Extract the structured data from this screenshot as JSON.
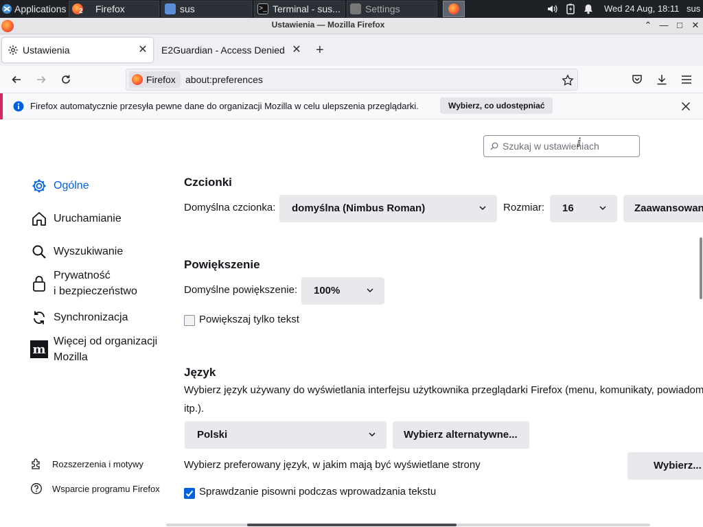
{
  "taskbar": {
    "applications_label": "Applications",
    "windows": [
      {
        "title": "Firefox",
        "icon": "firefox-icon"
      },
      {
        "title": "sus",
        "icon": "home-folder-icon"
      },
      {
        "title": "Terminal - sus...",
        "icon": "terminal-icon"
      },
      {
        "title": "Settings",
        "icon": "settings-icon"
      }
    ],
    "firefox_badge": "2",
    "clock": "Wed 24 Aug, 18:11",
    "user": "sus"
  },
  "window": {
    "title": "Ustawienia — Mozilla Firefox"
  },
  "tabs": [
    {
      "label": "Ustawienia",
      "icon": "gear-icon",
      "selected": true
    },
    {
      "label": "E2Guardian - Access Denied",
      "selected": false
    }
  ],
  "navbar": {
    "identity_label": "Firefox",
    "url": "about:preferences"
  },
  "notification": {
    "message": "Firefox automatycznie przesyła pewne dane do organizacji Mozilla w celu ulepszenia przeglądarki.",
    "button": "Wybierz, co udostępniać",
    "accent_color": "#d6285f"
  },
  "search": {
    "placeholder": "Szukaj w ustawieniach"
  },
  "sidebar": {
    "categories": [
      {
        "label": "Ogólne",
        "icon": "gear-icon",
        "selected": true
      },
      {
        "label": "Uruchamianie",
        "icon": "home-icon"
      },
      {
        "label": "Wyszukiwanie",
        "icon": "search-icon"
      },
      {
        "label_line1": "Prywatność",
        "label_line2": "i bezpieczeństwo",
        "icon": "lock-icon"
      },
      {
        "label": "Synchronizacja",
        "icon": "sync-icon"
      },
      {
        "label_line1": "Więcej od organizacji",
        "label_line2": "Mozilla",
        "icon": "mozilla-icon"
      }
    ],
    "bottom": [
      {
        "label": "Rozszerzenia i motywy",
        "icon": "puzzle-icon"
      },
      {
        "label": "Wsparcie programu Firefox",
        "icon": "help-icon"
      }
    ]
  },
  "fonts": {
    "heading": "Czcionki",
    "default_font_label": "Domyślna czcionka:",
    "default_font_value": "domyślna (Nimbus Roman)",
    "size_label": "Rozmiar:",
    "size_value": "16",
    "advanced_button": "Zaawansowane..."
  },
  "zoom": {
    "heading": "Powiększenie",
    "default_zoom_label": "Domyślne powiększenie:",
    "default_zoom_value": "100%",
    "text_only_label": "Powiększaj tylko tekst",
    "text_only_checked": false
  },
  "language": {
    "heading": "Język",
    "description_line1": "Wybierz język używany do wyświetlania interfejsu użytkownika przeglądarki Firefox (menu, komunikaty, powiadomienia",
    "description_line2": "itp.).",
    "ui_language_value": "Polski",
    "alternatives_button": "Wybierz alternatywne...",
    "pages_language_label": "Wybierz preferowany język, w jakim mają być wyświetlane strony",
    "pages_language_button": "Wybierz...",
    "spellcheck_label": "Sprawdzanie pisowni podczas wprowadzania tekstu",
    "spellcheck_checked": true
  },
  "colors": {
    "accent": "#0061e0",
    "taskbar_bg": "#1e2126"
  }
}
